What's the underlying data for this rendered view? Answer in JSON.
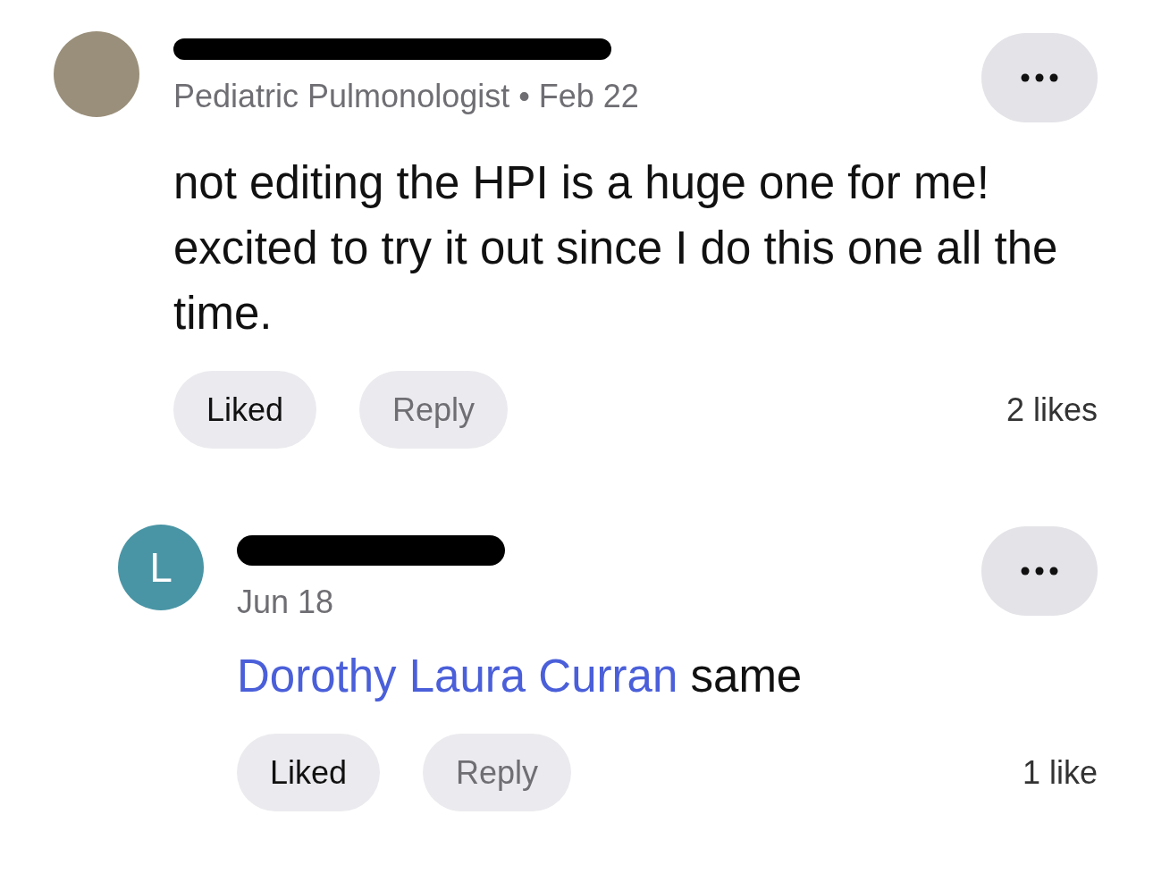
{
  "comments": [
    {
      "avatar": {
        "kind": "photo"
      },
      "name_redacted": true,
      "subtitle": "Pediatric Pulmonologist • Feb 22",
      "body": "not editing the HPI is a huge one for me! excited to try it out since I do this one all the time.",
      "like_button": {
        "label": "Liked",
        "liked": true
      },
      "reply_button": {
        "label": "Reply"
      },
      "likes": "2 likes",
      "indented": false
    },
    {
      "avatar": {
        "kind": "initial",
        "initial": "L",
        "color": "#4a95a5"
      },
      "name_redacted": true,
      "subtitle": "Jun 18",
      "mention": "Dorothy Laura Curran",
      "body": "same",
      "like_button": {
        "label": "Liked",
        "liked": true
      },
      "reply_button": {
        "label": "Reply"
      },
      "likes": "1 like",
      "indented": true
    }
  ]
}
